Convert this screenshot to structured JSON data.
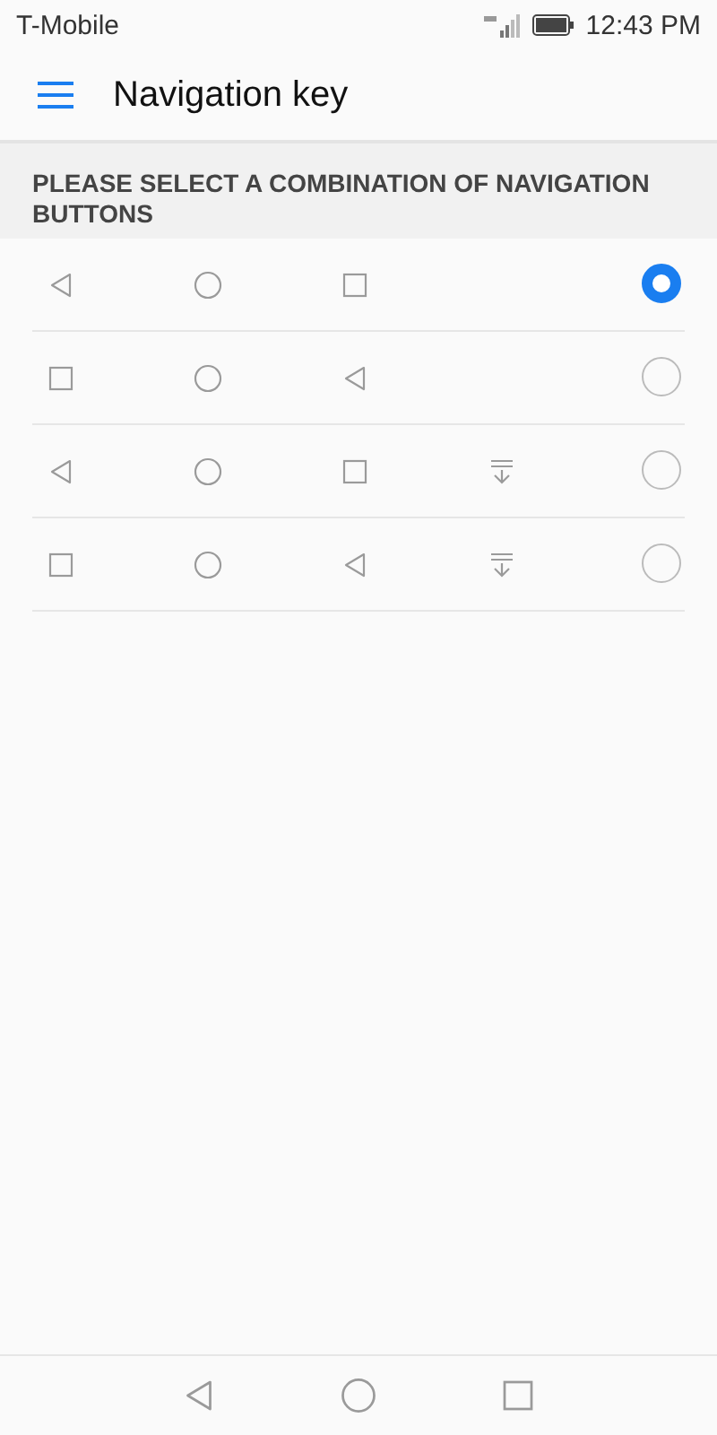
{
  "status_bar": {
    "carrier": "T-Mobile",
    "time": "12:43 PM"
  },
  "toolbar": {
    "title": "Navigation key"
  },
  "section": {
    "header": "PLEASE SELECT A COMBINATION OF NAVIGATION BUTTONS"
  },
  "options": [
    {
      "keys": [
        {
          "kind": "back"
        },
        {
          "kind": "home"
        },
        {
          "kind": "recent"
        }
      ],
      "selected": true
    },
    {
      "keys": [
        {
          "kind": "recent"
        },
        {
          "kind": "home"
        },
        {
          "kind": "back"
        }
      ],
      "selected": false
    },
    {
      "keys": [
        {
          "kind": "back"
        },
        {
          "kind": "home"
        },
        {
          "kind": "recent"
        },
        {
          "kind": "notification"
        }
      ],
      "selected": false
    },
    {
      "keys": [
        {
          "kind": "recent"
        },
        {
          "kind": "home"
        },
        {
          "kind": "back"
        },
        {
          "kind": "notification"
        }
      ],
      "selected": false
    }
  ],
  "nav_bar": [
    {
      "kind": "back"
    },
    {
      "kind": "home"
    },
    {
      "kind": "recent"
    }
  ]
}
